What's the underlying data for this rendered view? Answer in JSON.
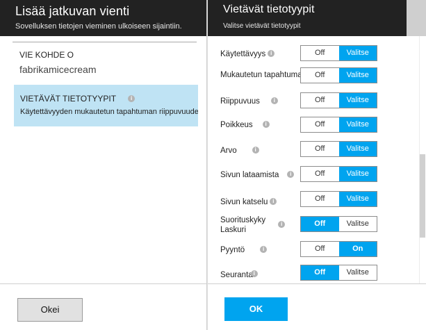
{
  "left": {
    "title": "Lisää jatkuvan vienti",
    "subtitle": "Sovelluksen tietojen vieminen ulkoiseen sijaintiin.",
    "destination": {
      "label": "VIE KOHDE O",
      "value": "fabrikamicecream"
    },
    "data_types": {
      "label": "VIETÄVÄT TIETOTYYPIT",
      "value": "Käytettävyyden mukautetun tapahtuman riippuvuuden, E"
    },
    "ok_label": "Okei"
  },
  "right": {
    "title": "Vietävät tietotyypit",
    "subtitle": "Valitse vietävät tietotyypit",
    "ok_label": "OK",
    "rows": [
      {
        "label": "Käytettävyys",
        "off": "Off",
        "on": "Valitse",
        "selected": "on"
      },
      {
        "label": "Mukautetun tapahtuman",
        "off": "Off",
        "on": "Valitse",
        "selected": "on"
      },
      {
        "label": "Riippuvuus",
        "off": "Off",
        "on": "Valitse",
        "selected": "on"
      },
      {
        "label": "Poikkeus",
        "off": "Off",
        "on": "Valitse",
        "selected": "on"
      },
      {
        "label": "Arvo",
        "off": "Off",
        "on": "Valitse",
        "selected": "on"
      },
      {
        "label": "Sivun lataamista",
        "off": "Off",
        "on": "Valitse",
        "selected": "on"
      },
      {
        "label": "Sivun katselu",
        "off": "Off",
        "on": "Valitse",
        "selected": "on"
      },
      {
        "label": "Suorituskyky",
        "label2": "Laskuri",
        "off": "Off",
        "on": "Valitse",
        "selected": "off"
      },
      {
        "label": "Pyyntö",
        "off": "Off",
        "on": "On",
        "selected": "on"
      },
      {
        "label": "Seuranta",
        "off": "Off",
        "on": "Valitse",
        "selected": "off"
      }
    ]
  },
  "colors": {
    "accent": "#00a4ef",
    "header": "#222222",
    "selected_item": "#bfe3f4"
  }
}
